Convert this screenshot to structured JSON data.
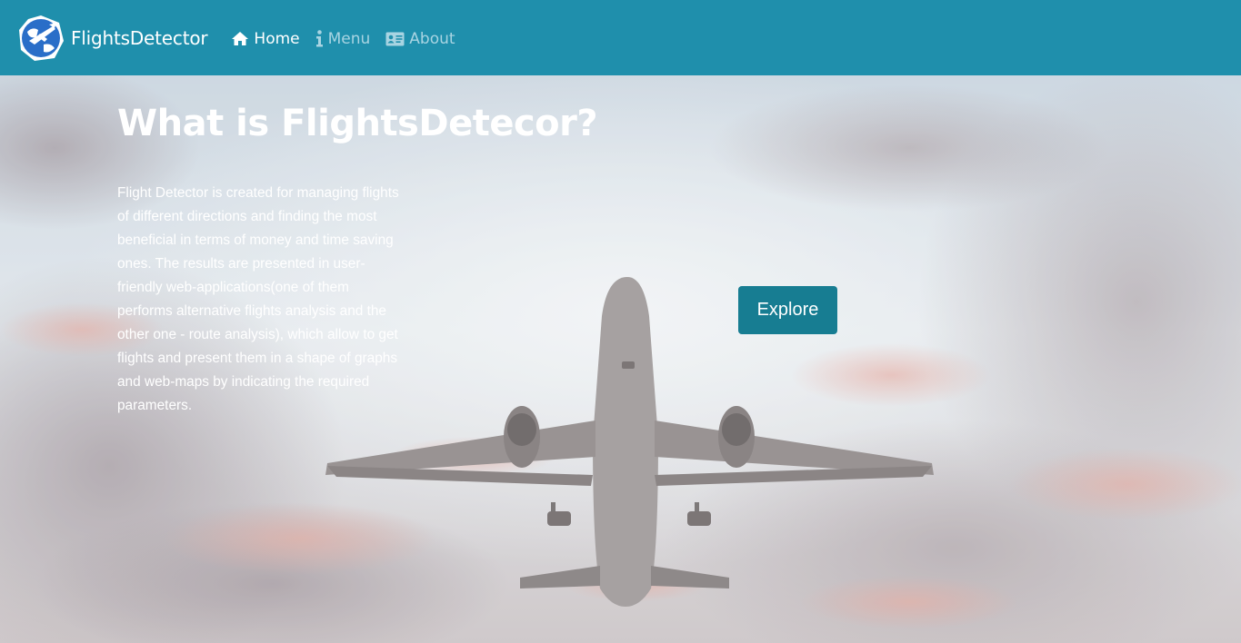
{
  "brand": {
    "name": "FlightsDetector",
    "logo_icon": "globe-plane-logo"
  },
  "nav": {
    "items": [
      {
        "label": "Home",
        "icon": "home-icon",
        "active": true
      },
      {
        "label": "Menu",
        "icon": "info-icon",
        "active": false
      },
      {
        "label": "About",
        "icon": "id-card-icon",
        "active": false
      }
    ]
  },
  "hero": {
    "title": "What is FlightsDetecor?",
    "description": "Flight Detector is created for managing flights of different directions and finding the most beneficial in terms of money and time saving ones. The results are presented in user-friendly web-applications(one of them performs alternative flights analysis and the other one - route analysis), which allow to get flights and present them in a shape of graphs and web-maps by indicating the required parameters.",
    "cta_label": "Explore"
  },
  "colors": {
    "navbar": "#1f8fac",
    "button": "#177d92",
    "nav_muted": "#a8d4e2"
  }
}
